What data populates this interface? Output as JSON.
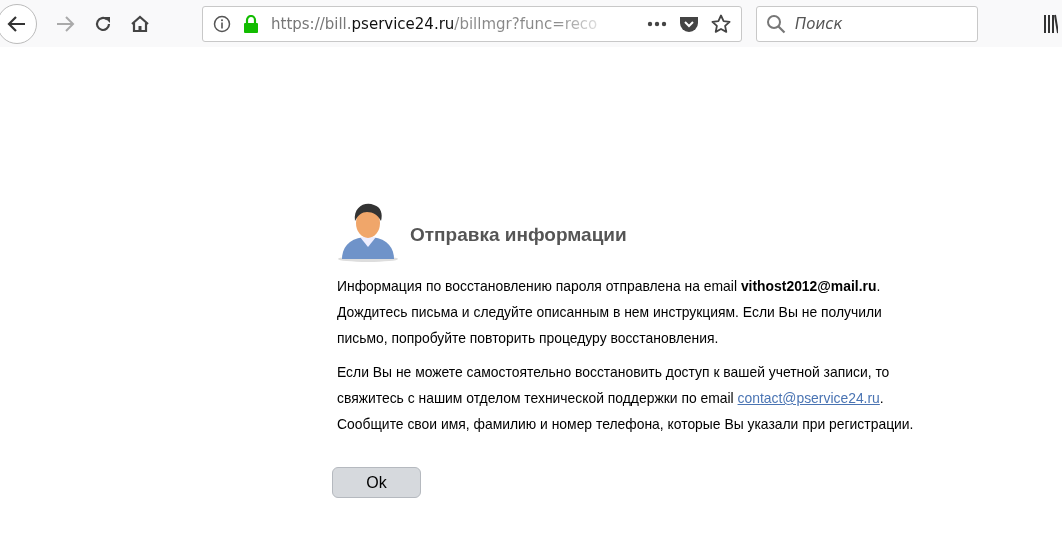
{
  "browser": {
    "back_disabled": false,
    "forward_disabled": true,
    "url": {
      "scheme": "https://bill.",
      "host": "pservice24.ru",
      "path": "/billmgr?func=reco"
    },
    "search": {
      "placeholder": "Поиск"
    }
  },
  "page": {
    "title": "Отправка информации",
    "paragraphs": [
      {
        "text": "Информация по восстановлению пароля отправлена на email **vithost2012@mail.ru**. Дождитесь письма и следуйте описанным в нем инструкциям. Если Вы не получили письмо, попробуйте повторить процедуру восстановления."
      },
      {
        "text": "Если Вы не можете самостоятельно восстановить доступ к вашей учетной записи, то свяжитесь с нашим отделом технической поддержки по email ",
        "link": "contact@pservice24.ru",
        "after": ". Сообщите свои имя, фамилию и номер телефона, которые Вы указали при регистрации."
      }
    ],
    "button": "Ok"
  }
}
